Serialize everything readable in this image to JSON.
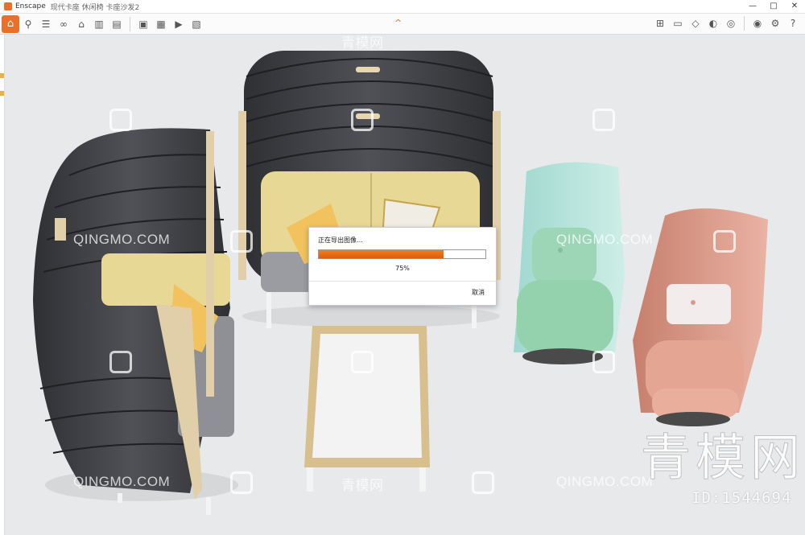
{
  "titlebar": {
    "app_name": "Enscape",
    "document": "现代卡座 休闲椅 卡座沙发2",
    "controls": {
      "minimize": "—",
      "maximize": "□",
      "close": "✕"
    }
  },
  "toolbar": {
    "home_icon": "home-icon",
    "left_tools": [
      "link-icon",
      "bim-icon",
      "glasses-icon",
      "library-icon",
      "asset-icon",
      "clapper-icon"
    ],
    "export_tools": [
      "screenshot-icon",
      "batch-render-icon",
      "video-export-icon",
      "exe-export-icon"
    ],
    "center_toggle": "^",
    "right_tools": [
      "map-icon",
      "monitor-icon",
      "cube-icon",
      "material-icon",
      "vr-icon",
      "eye-icon",
      "settings-icon",
      "help-icon"
    ]
  },
  "dialog": {
    "title": "正在导出图像…",
    "progress_percent": 75,
    "progress_label": "75%",
    "cancel_label": "取消"
  },
  "watermarks": {
    "text": "QINGMO.COM",
    "cn_text": "青模网",
    "brand": "青模网",
    "id_label": "ID:1544694"
  },
  "colors": {
    "accent": "#e8702a",
    "felt": "#3e3f43",
    "cushion_yellow": "#e6d592",
    "mint": "#a9dcc9",
    "pink": "#dd9a88",
    "floor": "#e8e9eb"
  }
}
